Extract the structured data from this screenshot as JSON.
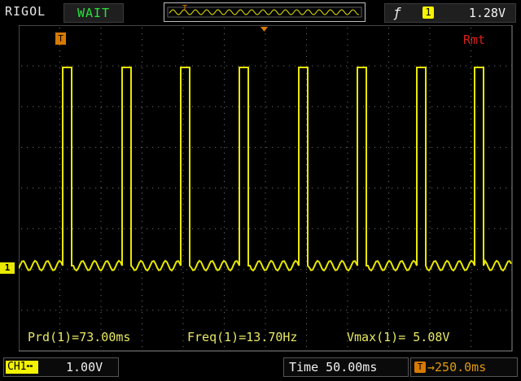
{
  "header": {
    "brand": "RIGOL",
    "status": "WAIT",
    "trigger_slope_icon": "rising-edge-icon",
    "trigger_source": "1",
    "trigger_level": "1.28V"
  },
  "screen": {
    "mode": "Rmt",
    "channel_marker": "1",
    "trigger_position_marker": "T",
    "measurements": [
      {
        "label": "Prd(1)=73.00ms"
      },
      {
        "label": "Freq(1)=13.70Hz"
      },
      {
        "label": "Vmax(1)= 5.08V"
      }
    ],
    "waveform_color": "#e8e800",
    "grid_color": "#6a6a6a"
  },
  "footer": {
    "channel_label": "CH1",
    "channel_scale": "1.00V",
    "timebase": "Time 50.00ms",
    "trigger_offset": "250.0ms"
  },
  "chart_data": {
    "type": "line",
    "series": [
      {
        "name": "",
        "pulse_count": 8,
        "period_ms": 73.0,
        "frequency_hz": 13.7,
        "vmax_v": 5.08
      }
    ],
    "grid": true
  }
}
